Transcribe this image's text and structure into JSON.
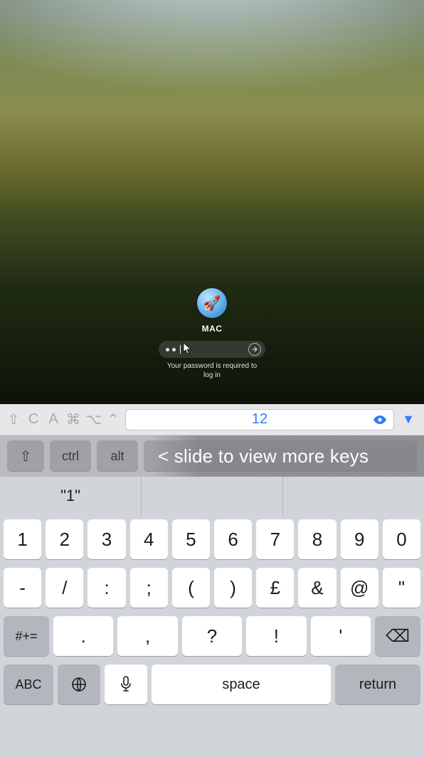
{
  "remote": {
    "username": "MAC",
    "avatar_emoji": "🚀",
    "password_value": "••",
    "hint": "Your password is required to\nlog in"
  },
  "toolbar": {
    "glyphs": [
      "⇧",
      "C",
      "A",
      "⌘",
      "⌥",
      "⌃"
    ],
    "field_value": "12",
    "eye_icon": "eye-icon",
    "dropdown_icon": "▼"
  },
  "modrow": {
    "shift_glyph": "⇧",
    "keys": [
      "ctrl",
      "alt"
    ],
    "overlay_text": "< slide to view more keys"
  },
  "keyboard": {
    "suggestions": [
      "\"1\"",
      "",
      ""
    ],
    "row1": [
      "1",
      "2",
      "3",
      "4",
      "5",
      "6",
      "7",
      "8",
      "9",
      "0"
    ],
    "row2": [
      "-",
      "/",
      ":",
      ";",
      "(",
      ")",
      "£",
      "&",
      "@",
      "\""
    ],
    "row3": {
      "left": "#+=",
      "mid": [
        ".",
        ",",
        "?",
        "!",
        "'"
      ],
      "right": "⌫"
    },
    "bottom": {
      "abc": "ABC",
      "globe": "🌐",
      "mic": "🎤",
      "space": "space",
      "return": "return"
    }
  }
}
